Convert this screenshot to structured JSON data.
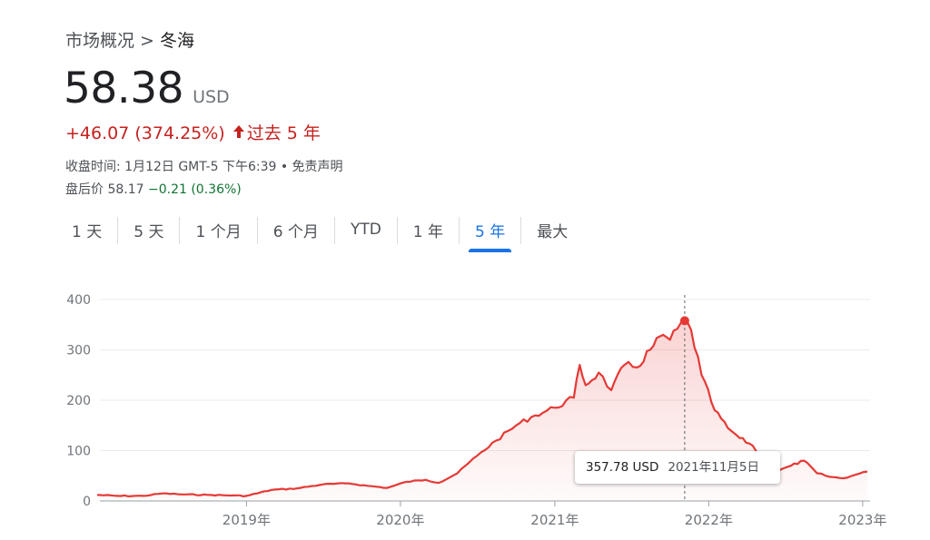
{
  "breadcrumb": {
    "parent": "市场概况",
    "separator": ">",
    "current": "冬海"
  },
  "quote": {
    "price": "58.38",
    "currency": "USD",
    "change": "+46.07 (374.25%)",
    "period": "过去 5 年",
    "close_info": "收盘时间: 1月12日 GMT-5 下午6:39 • 免责声明",
    "after_hours_label": "盘后价 58.17",
    "after_hours_change": "−0.21 (0.36%)"
  },
  "tabs": [
    "1 天",
    "5 天",
    "1 个月",
    "6 个月",
    "YTD",
    "1 年",
    "5 年",
    "最大"
  ],
  "active_tab": "5 年",
  "colors": {
    "line": "#e53935",
    "active_tab": "#1a73e8",
    "negative": "#c5221f",
    "positive": "#137333"
  },
  "tooltip": {
    "value": "357.78 USD",
    "date": "2021年11月5日"
  },
  "chart_data": {
    "type": "area",
    "title": "",
    "xlabel": "",
    "ylabel": "",
    "ylim": [
      0,
      400
    ],
    "y_ticks": [
      "0",
      "100",
      "200",
      "300",
      "400"
    ],
    "x_ticks": [
      "2019年",
      "2020年",
      "2021年",
      "2022年",
      "2023年"
    ],
    "grid": true,
    "series": [
      {
        "x": [
          "2018-01-12",
          "2018-03-01",
          "2018-05-01",
          "2018-06-15",
          "2018-08-01",
          "2018-10-01",
          "2018-12-01",
          "2019-01-01",
          "2019-03-01",
          "2019-05-01",
          "2019-07-01",
          "2019-09-01",
          "2019-10-15",
          "2019-12-01",
          "2020-01-15",
          "2020-03-01",
          "2020-04-01",
          "2020-05-15",
          "2020-07-01",
          "2020-08-15",
          "2020-10-01",
          "2020-11-15",
          "2021-01-01",
          "2021-02-15",
          "2021-03-01",
          "2021-03-15",
          "2021-04-15",
          "2021-05-15",
          "2021-06-15",
          "2021-07-15",
          "2021-08-15",
          "2021-09-15",
          "2021-10-01",
          "2021-11-05",
          "2021-11-20",
          "2021-12-15",
          "2022-01-15",
          "2022-02-15",
          "2022-03-15",
          "2022-04-15",
          "2022-05-15",
          "2022-06-15",
          "2022-07-15",
          "2022-08-15",
          "2022-09-15",
          "2022-10-15",
          "2022-11-15",
          "2022-12-15",
          "2023-01-12"
        ],
        "values": [
          12,
          10,
          10,
          15,
          13,
          12,
          11,
          10,
          22,
          25,
          33,
          35,
          30,
          26,
          38,
          42,
          36,
          55,
          90,
          120,
          150,
          170,
          185,
          205,
          270,
          230,
          255,
          220,
          270,
          265,
          300,
          330,
          320,
          357.78,
          340,
          250,
          180,
          145,
          125,
          110,
          75,
          60,
          70,
          80,
          55,
          48,
          45,
          52,
          58.38
        ]
      }
    ]
  }
}
